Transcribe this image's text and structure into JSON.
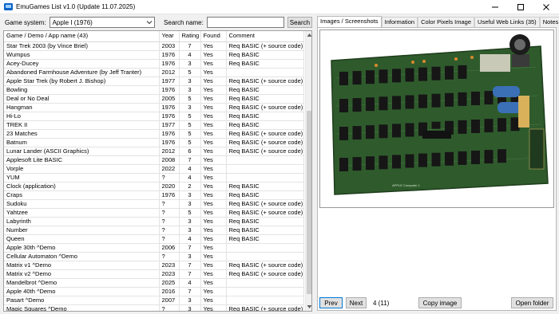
{
  "window": {
    "title": "EmuGames List v1.0 (Update 11.07.2025)"
  },
  "toolbar": {
    "system_label": "Game system:",
    "system_value": "Apple I (1976)",
    "search_label": "Search name:",
    "search_value": "",
    "search_button": "Search"
  },
  "table": {
    "headers": [
      "Game / Demo / App name (43)",
      "Year",
      "Rating",
      "Found",
      "Comment"
    ],
    "rows": [
      [
        "Star Trek 2003 (by Vince Briel)",
        "2003",
        "7",
        "Yes",
        "Req BASIC (+ source code)"
      ],
      [
        "Wumpus",
        "1976",
        "4",
        "Yes",
        "Req BASIC"
      ],
      [
        "Acey-Ducey",
        "1976",
        "3",
        "Yes",
        "Req BASIC"
      ],
      [
        "Abandoned Farmhouse Adventure (by Jeff Tranter)",
        "2012",
        "5",
        "Yes",
        ""
      ],
      [
        "Apple Star Trek (by Robert J. Bishop)",
        "1977",
        "3",
        "Yes",
        "Req BASIC (+ source code)"
      ],
      [
        "Bowling",
        "1976",
        "3",
        "Yes",
        "Req BASIC"
      ],
      [
        "Deal or No Deal",
        "2005",
        "5",
        "Yes",
        "Req BASIC"
      ],
      [
        "Hangman",
        "1976",
        "3",
        "Yes",
        "Req BASIC (+ source code)"
      ],
      [
        "Hi-Lo",
        "1976",
        "5",
        "Yes",
        "Req BASIC"
      ],
      [
        "TREK II",
        "1977",
        "5",
        "Yes",
        "Req BASIC"
      ],
      [
        "23 Matches",
        "1976",
        "5",
        "Yes",
        "Req BASIC (+ source code)"
      ],
      [
        "Batnum",
        "1976",
        "5",
        "Yes",
        "Req BASIC (+ source code)"
      ],
      [
        "Lunar Lander (ASCII Graphics)",
        "2012",
        "6",
        "Yes",
        "Req BASIC (+ source code)"
      ],
      [
        "Applesoft Lite BASIC",
        "2008",
        "7",
        "Yes",
        ""
      ],
      [
        "Vorple",
        "2022",
        "4",
        "Yes",
        ""
      ],
      [
        "YUM",
        "?",
        "4",
        "Yes",
        ""
      ],
      [
        "Clock (application)",
        "2020",
        "2",
        "Yes",
        "Req BASIC"
      ],
      [
        "Craps",
        "1976",
        "3",
        "Yes",
        "Req BASIC"
      ],
      [
        "Sudoku",
        "?",
        "3",
        "Yes",
        "Req BASIC (+ source code)"
      ],
      [
        "Yahtzee",
        "?",
        "5",
        "Yes",
        "Req BASIC (+ source code)"
      ],
      [
        "Labyrinth",
        "?",
        "3",
        "Yes",
        "Req BASIC"
      ],
      [
        "Number",
        "?",
        "3",
        "Yes",
        "Req BASIC"
      ],
      [
        "Queen",
        "?",
        "4",
        "Yes",
        "Req BASIC"
      ],
      [
        "Apple 30th ^Demo",
        "2006",
        "7",
        "Yes",
        ""
      ],
      [
        "Cellular Automaton ^Demo",
        "?",
        "3",
        "Yes",
        ""
      ],
      [
        "Matrix v1 ^Demo",
        "2023",
        "7",
        "Yes",
        "Req BASIC (+ source code)"
      ],
      [
        "Matrix v2 ^Demo",
        "2023",
        "7",
        "Yes",
        "Req BASIC (+ source code)"
      ],
      [
        "Mandelbrot ^Demo",
        "2025",
        "4",
        "Yes",
        ""
      ],
      [
        "Apple 40th ^Demo",
        "2016",
        "7",
        "Yes",
        ""
      ],
      [
        "Pasart ^Demo",
        "2007",
        "3",
        "Yes",
        ""
      ],
      [
        "Magic Squares ^Demo",
        "?",
        "3",
        "Yes",
        "Req BASIC (+ source code)"
      ]
    ]
  },
  "tabs": [
    {
      "label": "Images / Screenshots",
      "active": true
    },
    {
      "label": "Information",
      "active": false
    },
    {
      "label": "Color Pixels Image",
      "active": false
    },
    {
      "label": "Useful Web Links (35)",
      "active": false
    },
    {
      "label": "Notes",
      "active": false
    }
  ],
  "image_viewer": {
    "prev_button": "Prev",
    "next_button": "Next",
    "counter": "4 (11)",
    "copy_button": "Copy image",
    "open_folder_button": "Open folder",
    "board_text": "APPLE Computer 1"
  },
  "colors": {
    "accent": "#0078d7",
    "board_green": "#2f5b2c",
    "titlebar": "#ffffff"
  }
}
